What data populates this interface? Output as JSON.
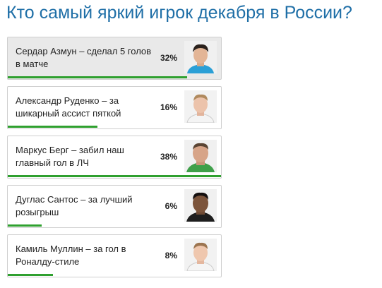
{
  "poll": {
    "title": "Кто самый яркий игрок декабря в России?",
    "accent_color": "#2fa02f",
    "title_color": "#1f6fa7",
    "options": [
      {
        "label": "Сердар Азмун – сделал 5 голов в матче",
        "percent": 32,
        "percent_text": "32%",
        "selected": true,
        "icon": "player-photo-icon"
      },
      {
        "label": "Александр Руденко – за шикарный ассист пяткой",
        "percent": 16,
        "percent_text": "16%",
        "selected": false,
        "icon": "player-photo-icon"
      },
      {
        "label": "Маркус Берг – забил наш главный гол в ЛЧ",
        "percent": 38,
        "percent_text": "38%",
        "selected": false,
        "icon": "player-photo-icon"
      },
      {
        "label": "Дуглас Сантос – за лучший розыгрыш",
        "percent": 6,
        "percent_text": "6%",
        "selected": false,
        "icon": "player-photo-icon"
      },
      {
        "label": "Камиль Муллин – за гол в Роналду-стиле",
        "percent": 8,
        "percent_text": "8%",
        "selected": false,
        "icon": "player-photo-icon"
      }
    ]
  }
}
